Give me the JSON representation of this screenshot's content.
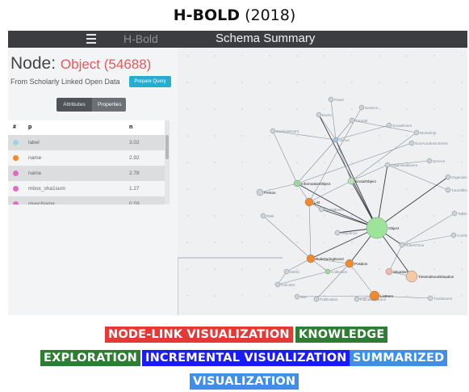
{
  "page": {
    "title_bold": "H-BOLD",
    "title_year": "(2018)"
  },
  "topbar": {
    "brand": "H-Bold",
    "title": "Schema Summary"
  },
  "panel": {
    "node_label": "Node:",
    "node_value": "Object (54688)",
    "source": "From Scholarly Linked Open Data",
    "prepare_button": "Prepare Query",
    "tabs": [
      "Attributes",
      "Properties"
    ],
    "columns": {
      "hash": "#",
      "p": "p",
      "n": "n"
    },
    "rows": [
      {
        "p": "label",
        "n": "3.02",
        "color": "#9fd5df"
      },
      {
        "p": "name",
        "n": "2.92",
        "color": "#f08a2c"
      },
      {
        "p": "name",
        "n": "2.78",
        "color": "#d86fc0"
      },
      {
        "p": "mbox_sha1sum",
        "n": "1.27",
        "color": "#d86fc0"
      },
      {
        "p": "givenName",
        "n": "0.59",
        "color": "#d86fc0"
      }
    ]
  },
  "graph_labels": [
    "Panel",
    "Session",
    "Event",
    "Tutorial",
    "SocialEvent",
    "Workshop",
    "NonAcademicEvent",
    "SessionEvent",
    "Venue",
    "OrganisedEvent",
    "Service",
    "OrganisingRole",
    "InformationObject",
    "SocialObject",
    "TutorialEvent",
    "Person",
    "List",
    "SocialEvent",
    "Role",
    "TalkEvent",
    "Object",
    "Sequence",
    "RoleInTime",
    "ConferenceEvent",
    "RoleDuringEvent",
    "Position",
    "Collection",
    "Situation",
    "TimeIndexedSituation",
    "Metric",
    "Indicator",
    "ListItem",
    "TrackEvent",
    "Site",
    "Publication",
    "IndicatorSource"
  ],
  "tags": [
    {
      "text": "NODE-LINK VISUALIZATION",
      "color": "#e53935"
    },
    {
      "text": "KNOWLEDGE",
      "color": "#2e7d32"
    },
    {
      "text": "EXPLORATION",
      "color": "#2e7d32"
    },
    {
      "text": "INCREMENTAL VISUALIZATION",
      "color": "#1a1aff"
    },
    {
      "text": "SUMMARIZED",
      "color": "#3f8fe8"
    },
    {
      "text": "VISUALIZATION",
      "color": "#3f8fe8"
    }
  ]
}
